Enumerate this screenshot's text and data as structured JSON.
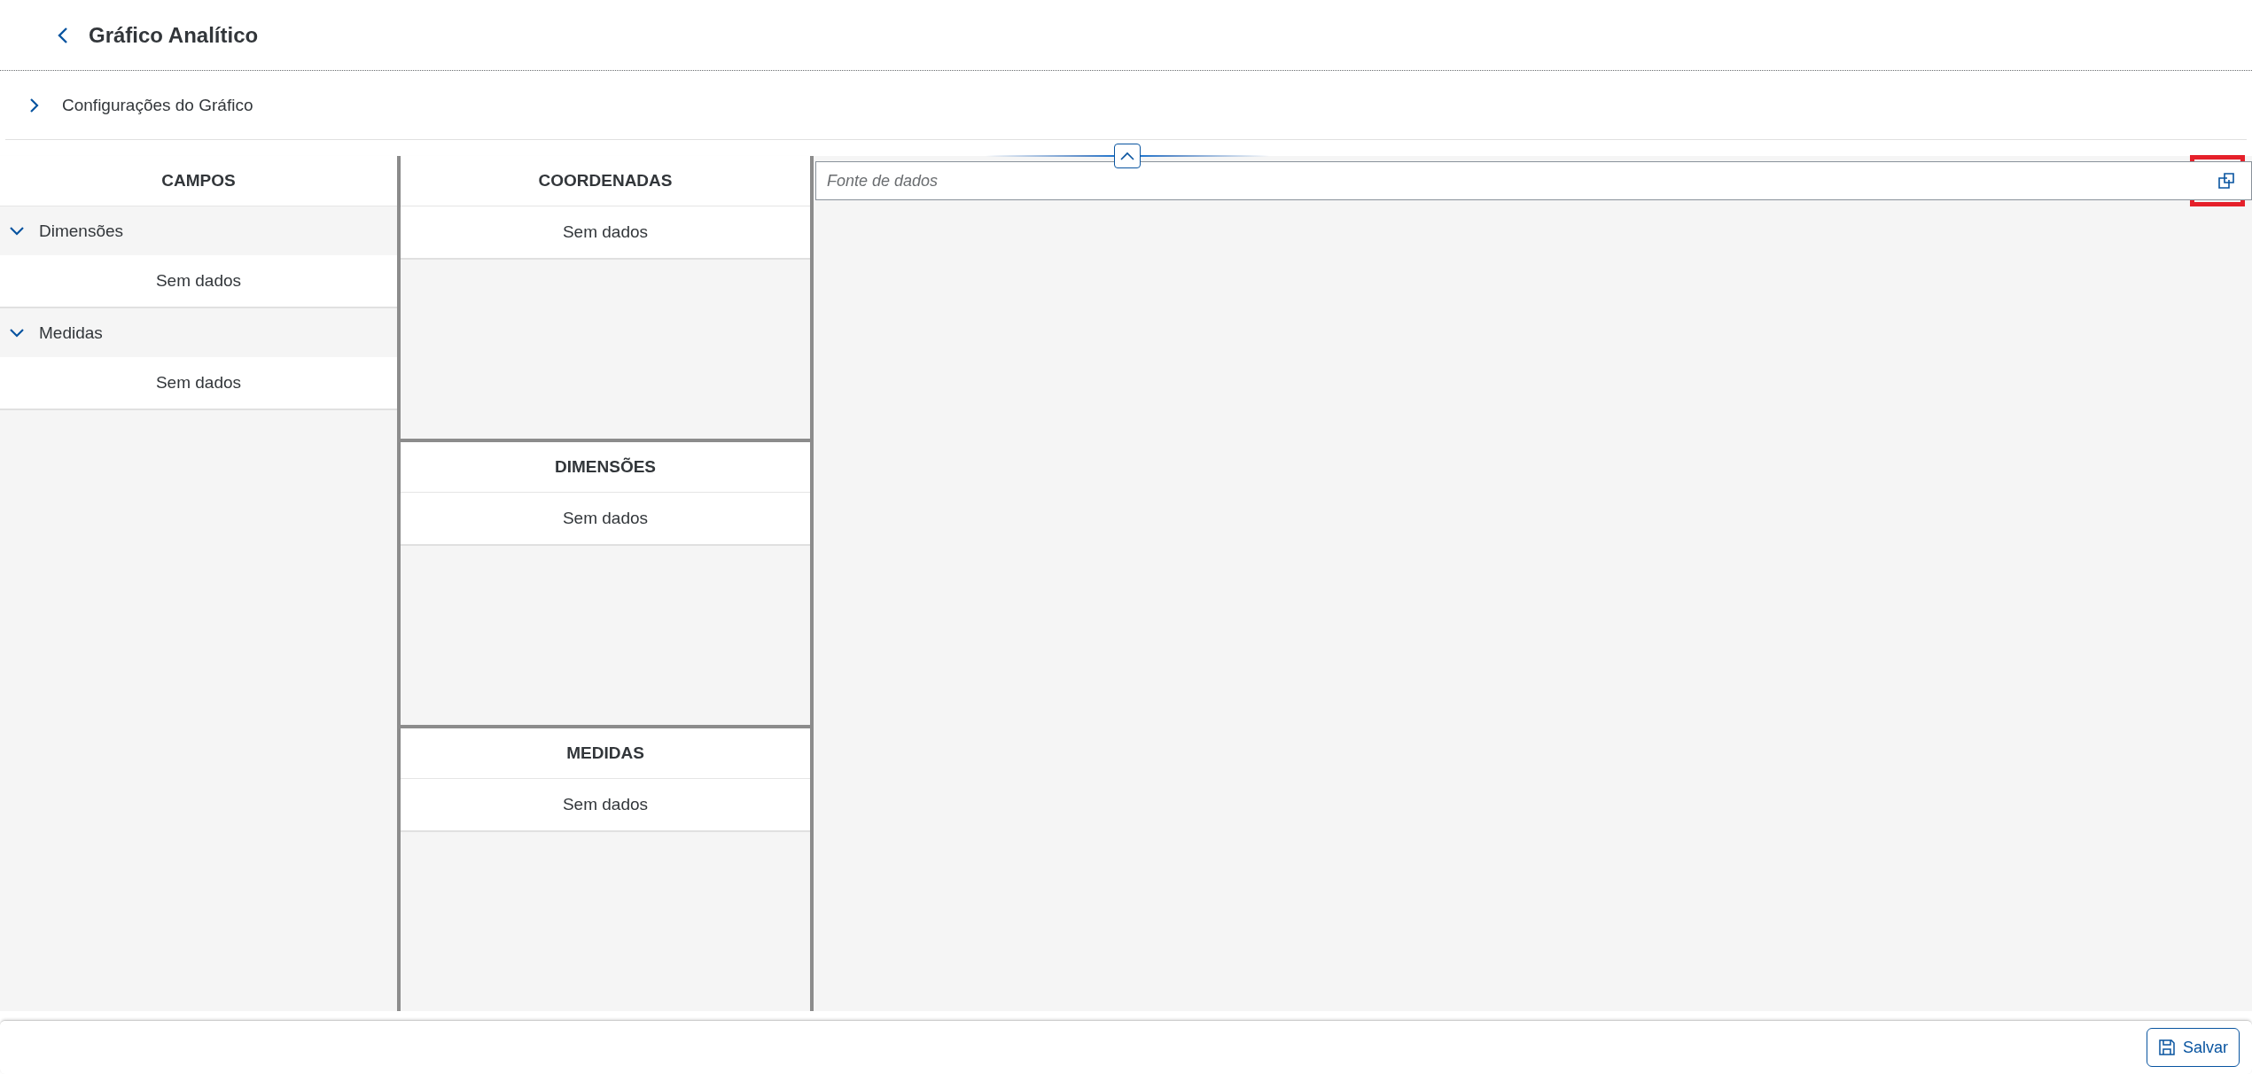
{
  "header": {
    "title": "Gráfico Analítico"
  },
  "settings_panel": {
    "label": "Configurações do Gráfico",
    "expanded": false
  },
  "fields": {
    "title": "CAMPOS",
    "groups": [
      {
        "label": "Dimensões",
        "expanded": true,
        "empty_text": "Sem dados"
      },
      {
        "label": "Medidas",
        "expanded": true,
        "empty_text": "Sem dados"
      }
    ]
  },
  "drop_zones": [
    {
      "title": "COORDENADAS",
      "empty_text": "Sem dados"
    },
    {
      "title": "DIMENSÕES",
      "empty_text": "Sem dados"
    },
    {
      "title": "MEDIDAS",
      "empty_text": "Sem dados"
    }
  ],
  "data_source": {
    "placeholder": "Fonte de dados",
    "value_help_highlighted": true
  },
  "footer": {
    "buttons": [
      {
        "label": "Salvar",
        "kind": "save"
      }
    ]
  }
}
